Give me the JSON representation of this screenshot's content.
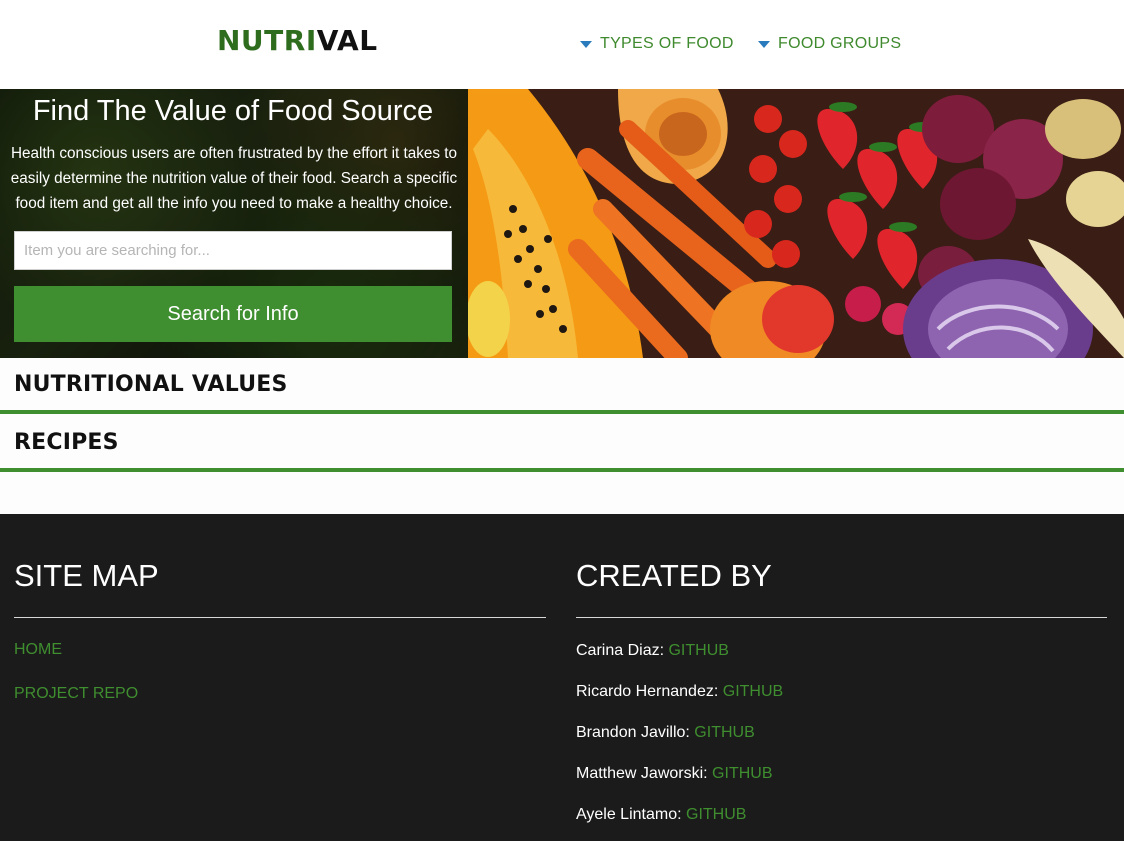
{
  "header": {
    "logo_part1": "NUTRI",
    "logo_part2": "VAL",
    "nav": [
      {
        "label": "TYPES OF FOOD"
      },
      {
        "label": "FOOD GROUPS"
      }
    ]
  },
  "hero": {
    "title": "Find The Value of Food Source",
    "description": "Health conscious users are often frustrated by the effort it takes to easily determine the nutrition value of their food. Search a specific food item and get all the info you need to make a healthy choice.",
    "search_placeholder": "Item you are searching for...",
    "search_button": "Search for Info"
  },
  "sections": [
    {
      "title": "NUTRITIONAL VALUES"
    },
    {
      "title": "RECIPES"
    }
  ],
  "footer": {
    "site_map_heading": "SITE MAP",
    "site_map_links": [
      {
        "label": "HOME"
      },
      {
        "label": "PROJECT REPO"
      }
    ],
    "created_by_heading": "CREATED BY",
    "creators": [
      {
        "name": "Carina Diaz:",
        "link": "GITHUB"
      },
      {
        "name": "Ricardo Hernandez:",
        "link": "GITHUB"
      },
      {
        "name": "Brandon Javillo:",
        "link": "GITHUB"
      },
      {
        "name": "Matthew Jaworski:",
        "link": "GITHUB"
      },
      {
        "name": "Ayele Lintamo:",
        "link": "GITHUB"
      }
    ]
  },
  "colors": {
    "brand_green": "#3f8e2f",
    "logo_green": "#2f6d1e",
    "footer_bg": "#1b1b1b",
    "caret_blue": "#2a7bbd"
  }
}
